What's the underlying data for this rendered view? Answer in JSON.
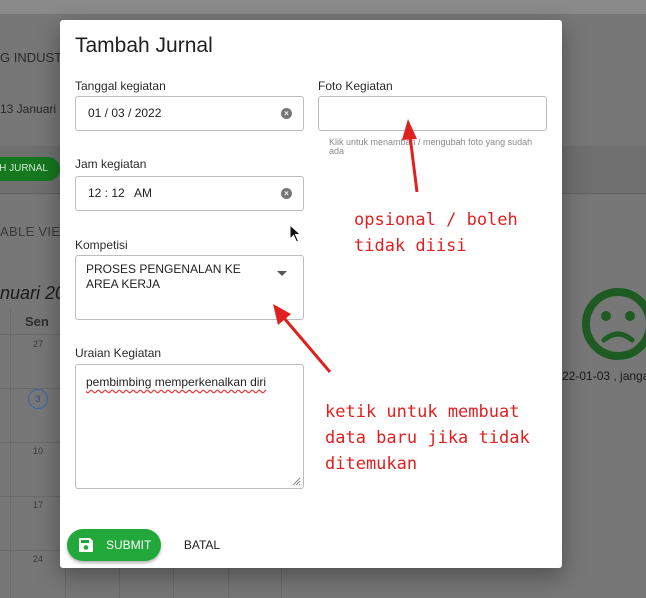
{
  "background": {
    "org_text": "G INDUST",
    "date_text": "13 Januari",
    "jurnal_button": "AH JURNAL",
    "view_text": "ABLE VIEW",
    "month_text": "nuari 20",
    "day_header": "Sen",
    "day_numbers": [
      "27",
      "3",
      "10",
      "17",
      "24"
    ],
    "face_caption": "22-01-03 , janga",
    "face_color": "#2e7d32"
  },
  "dialog": {
    "title": "Tambah Jurnal",
    "tanggal": {
      "label": "Tanggal kegiatan",
      "value": "01 / 03 / 2022"
    },
    "jam": {
      "label": "Jam kegiatan",
      "value": "12 : 12   AM"
    },
    "kompetisi": {
      "label": "Kompetisi",
      "value_line1": "PROSES PENGENALAN KE",
      "value_line2": "AREA KERJA"
    },
    "uraian": {
      "label": "Uraian Kegiatan",
      "value": "pembimbing memperkenalkan diri"
    },
    "foto": {
      "label": "Foto Kegiatan",
      "hint": "Klik untuk menambah / mengubah foto yang sudah ada"
    },
    "submit_label": "SUBMIT",
    "batal_label": "BATAL",
    "submit_color": "#22a83a"
  },
  "annotations": {
    "opsional_line1": "opsional / boleh",
    "opsional_line2": "tidak diisi",
    "ketik_line1": "ketik untuk membuat",
    "ketik_line2": "data baru jika tidak",
    "ketik_line3": "ditemukan",
    "color": "#e02020"
  }
}
